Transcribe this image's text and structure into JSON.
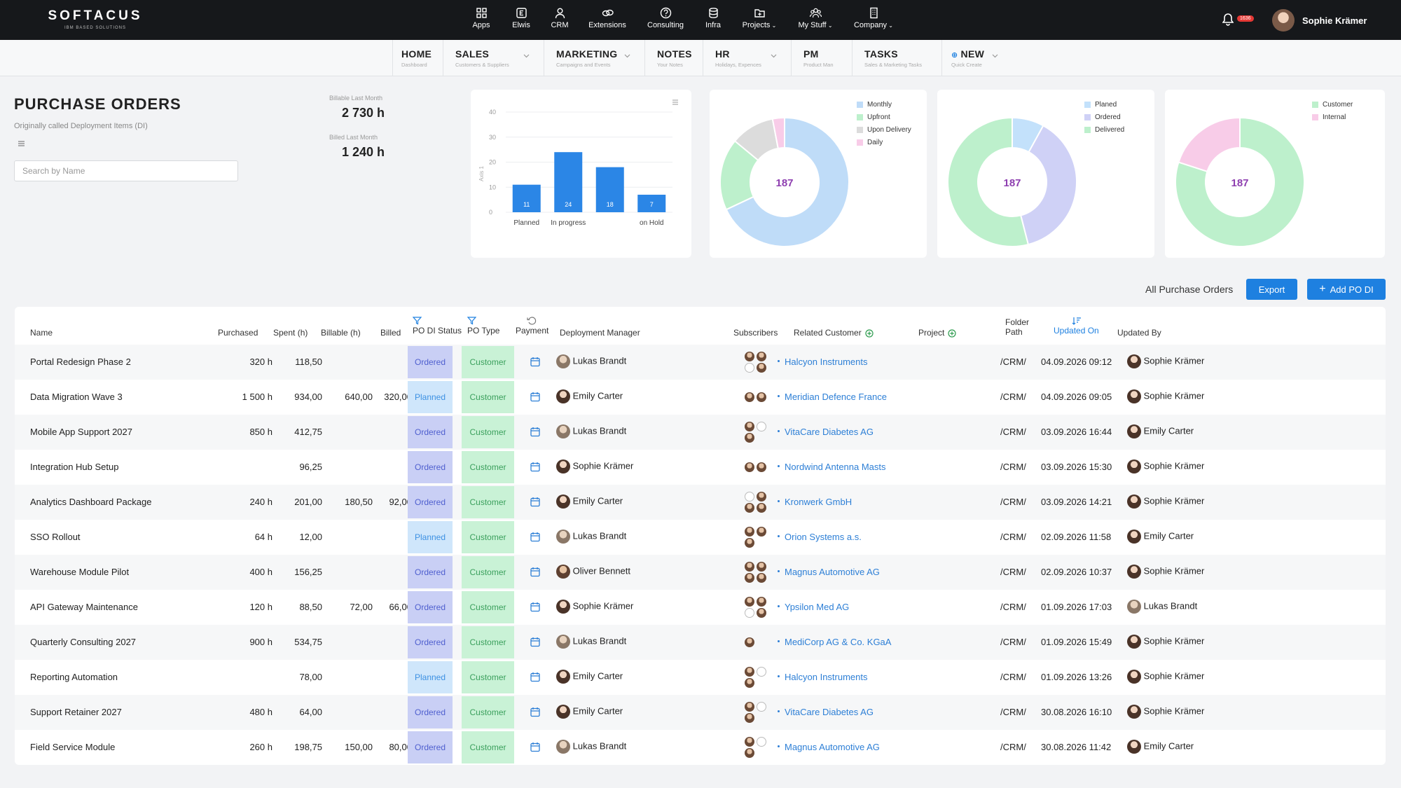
{
  "brand": {
    "name": "SOFTACUS",
    "tagline": "IBM BASED SOLUTIONS"
  },
  "topnav": [
    {
      "label": "Apps",
      "icon": "grid-icon"
    },
    {
      "label": "Elwis",
      "icon": "e-square-icon"
    },
    {
      "label": "CRM",
      "icon": "person-icon"
    },
    {
      "label": "Extensions",
      "icon": "link-icon"
    },
    {
      "label": "Consulting",
      "icon": "help-circle-icon"
    },
    {
      "label": "Infra",
      "icon": "database-icon"
    },
    {
      "label": "Projects",
      "icon": "folder-plus-icon"
    },
    {
      "label": "My Stuff",
      "icon": "people-icon"
    },
    {
      "label": "Company",
      "icon": "building-icon"
    }
  ],
  "user": {
    "name": "Sophie Krämer",
    "notification_count": "1636"
  },
  "subnav": [
    {
      "title": "HOME",
      "sub": "Dashboard"
    },
    {
      "title": "SALES",
      "sub": "Customers & Suppliers"
    },
    {
      "title": "MARKETING",
      "sub": "Campaigns and Events"
    },
    {
      "title": "NOTES",
      "sub": "Your Notes"
    },
    {
      "title": "HR",
      "sub": "Holidays, Expences"
    },
    {
      "title": "PM",
      "sub": "Product Man"
    },
    {
      "title": "TASKS",
      "sub": "Sales & Marketing Tasks"
    },
    {
      "title": "NEW",
      "sub": "Quick Create"
    }
  ],
  "page": {
    "title": "PURCHASE ORDERS",
    "subtitle": "Originally called Deployment Items (DI)",
    "search_placeholder": "Search by Name"
  },
  "kpis": {
    "billable_label": "Billable Last Month",
    "billable_value": "2 730 h",
    "billed_label": "Billed Last Month",
    "billed_value": "1 240 h"
  },
  "chart_data": [
    {
      "type": "bar",
      "categories": [
        "Planned",
        "In progress",
        "",
        "on Hold"
      ],
      "values": [
        11,
        24,
        18,
        7
      ],
      "ylabel": "Axis 1",
      "ylim": [
        0,
        40
      ],
      "yticks": [
        "0",
        "10",
        "20",
        "30",
        "40"
      ],
      "color": "#2b86e6",
      "grid": true
    },
    {
      "type": "pie",
      "donut": true,
      "center_label": "187",
      "labels": [
        "Monthly",
        "Upfront",
        "Upon Delivery",
        "Daily"
      ],
      "values": [
        68,
        18,
        11,
        3
      ],
      "colors": [
        "#bfdcf8",
        "#bdf0cc",
        "#dcdcdc",
        "#f8cce8"
      ]
    },
    {
      "type": "pie",
      "donut": true,
      "center_label": "187",
      "labels": [
        "Planed",
        "Ordered",
        "Delivered"
      ],
      "values": [
        8,
        38,
        54
      ],
      "colors": [
        "#c3e1fb",
        "#cfd1f6",
        "#bdf0cc"
      ]
    },
    {
      "type": "pie",
      "donut": true,
      "center_label": "187",
      "labels": [
        "Customer",
        "Internal"
      ],
      "values": [
        80,
        20
      ],
      "colors": [
        "#bdf0cc",
        "#f8cce8"
      ]
    }
  ],
  "toolbar": {
    "label": "All Purchase Orders",
    "export_label": "Export",
    "add_label": "Add PO DI"
  },
  "columns": {
    "name": "Name",
    "purchased": "Purchased",
    "spent": "Spent (h)",
    "billable": "Billable (h)",
    "billed": "Billed",
    "status": "PO DI Status",
    "type": "PO Type",
    "payment": "Payment",
    "manager": "Deployment Manager",
    "subscribers": "Subscribers",
    "customer": "Related Customer",
    "project": "Project",
    "folder": "Folder Path",
    "updated_on": "Updated On",
    "updated_by": "Updated By"
  },
  "rows": [
    {
      "name": "Portal Redesign Phase 2",
      "purchased": "320 h",
      "spent": "118,50",
      "billable": "",
      "billed": "",
      "status": "Ordered",
      "type": "Customer",
      "manager": "Lukas Brandt",
      "customer": "Halcyon Instruments",
      "folder": "/CRM/",
      "updated_on": "04.09.2026 09:12",
      "updated_by": "Sophie Krämer"
    },
    {
      "name": "Data Migration Wave 3",
      "purchased": "1 500 h",
      "spent": "934,00",
      "billable": "640,00",
      "billed": "320,00",
      "status": "Planned",
      "type": "Customer",
      "manager": "Emily Carter",
      "customer": "Meridian Defence France",
      "folder": "/CRM/",
      "updated_on": "04.09.2026 09:05",
      "updated_by": "Sophie Krämer"
    },
    {
      "name": "Mobile App Support 2027",
      "purchased": "850 h",
      "spent": "412,75",
      "billable": "",
      "billed": "",
      "status": "Ordered",
      "type": "Customer",
      "manager": "Lukas Brandt",
      "customer": "VitaCare Diabetes AG",
      "folder": "/CRM/",
      "updated_on": "03.09.2026 16:44",
      "updated_by": "Emily Carter"
    },
    {
      "name": "Integration Hub Setup",
      "purchased": "",
      "spent": "96,25",
      "billable": "",
      "billed": "",
      "status": "Ordered",
      "type": "Customer",
      "manager": "Sophie Krämer",
      "customer": "Nordwind Antenna Masts",
      "folder": "/CRM/",
      "updated_on": "03.09.2026 15:30",
      "updated_by": "Sophie Krämer"
    },
    {
      "name": "Analytics Dashboard Package",
      "purchased": "240 h",
      "spent": "201,00",
      "billable": "180,50",
      "billed": "92,00",
      "status": "Ordered",
      "type": "Customer",
      "manager": "Emily Carter",
      "customer": "Kronwerk GmbH",
      "folder": "/CRM/",
      "updated_on": "03.09.2026 14:21",
      "updated_by": "Sophie Krämer"
    },
    {
      "name": "SSO Rollout",
      "purchased": "64 h",
      "spent": "12,00",
      "billable": "",
      "billed": "",
      "status": "Planned",
      "type": "Customer",
      "manager": "Lukas Brandt",
      "customer": "Orion Systems a.s.",
      "folder": "/CRM/",
      "updated_on": "02.09.2026 11:58",
      "updated_by": "Emily Carter"
    },
    {
      "name": "Warehouse Module Pilot",
      "purchased": "400 h",
      "spent": "156,25",
      "billable": "",
      "billed": "",
      "status": "Ordered",
      "type": "Customer",
      "manager": "Oliver Bennett",
      "customer": "Magnus Automotive AG",
      "folder": "/CRM/",
      "updated_on": "02.09.2026 10:37",
      "updated_by": "Sophie Krämer"
    },
    {
      "name": "API Gateway Maintenance",
      "purchased": "120 h",
      "spent": "88,50",
      "billable": "72,00",
      "billed": "66,00",
      "status": "Ordered",
      "type": "Customer",
      "manager": "Sophie Krämer",
      "customer": "Ypsilon Med AG",
      "folder": "/CRM/",
      "updated_on": "01.09.2026 17:03",
      "updated_by": "Lukas Brandt"
    },
    {
      "name": "Quarterly Consulting 2027",
      "purchased": "900 h",
      "spent": "534,75",
      "billable": "",
      "billed": "",
      "status": "Ordered",
      "type": "Customer",
      "manager": "Lukas Brandt",
      "customer": "MediCorp AG & Co. KGaA",
      "folder": "/CRM/",
      "updated_on": "01.09.2026 15:49",
      "updated_by": "Sophie Krämer"
    },
    {
      "name": "Reporting Automation",
      "purchased": "",
      "spent": "78,00",
      "billable": "",
      "billed": "",
      "status": "Planned",
      "type": "Customer",
      "manager": "Emily Carter",
      "customer": "Halcyon Instruments",
      "folder": "/CRM/",
      "updated_on": "01.09.2026 13:26",
      "updated_by": "Sophie Krämer"
    },
    {
      "name": "Support Retainer 2027",
      "purchased": "480 h",
      "spent": "64,00",
      "billable": "",
      "billed": "",
      "status": "Ordered",
      "type": "Customer",
      "manager": "Emily Carter",
      "customer": "VitaCare Diabetes AG",
      "folder": "/CRM/",
      "updated_on": "30.08.2026 16:10",
      "updated_by": "Sophie Krämer"
    },
    {
      "name": "Field Service Module",
      "purchased": "260 h",
      "spent": "198,75",
      "billable": "150,00",
      "billed": "80,00",
      "status": "Ordered",
      "type": "Customer",
      "manager": "Lukas Brandt",
      "customer": "Magnus Automotive AG",
      "folder": "/CRM/",
      "updated_on": "30.08.2026 11:42",
      "updated_by": "Emily Carter"
    }
  ]
}
